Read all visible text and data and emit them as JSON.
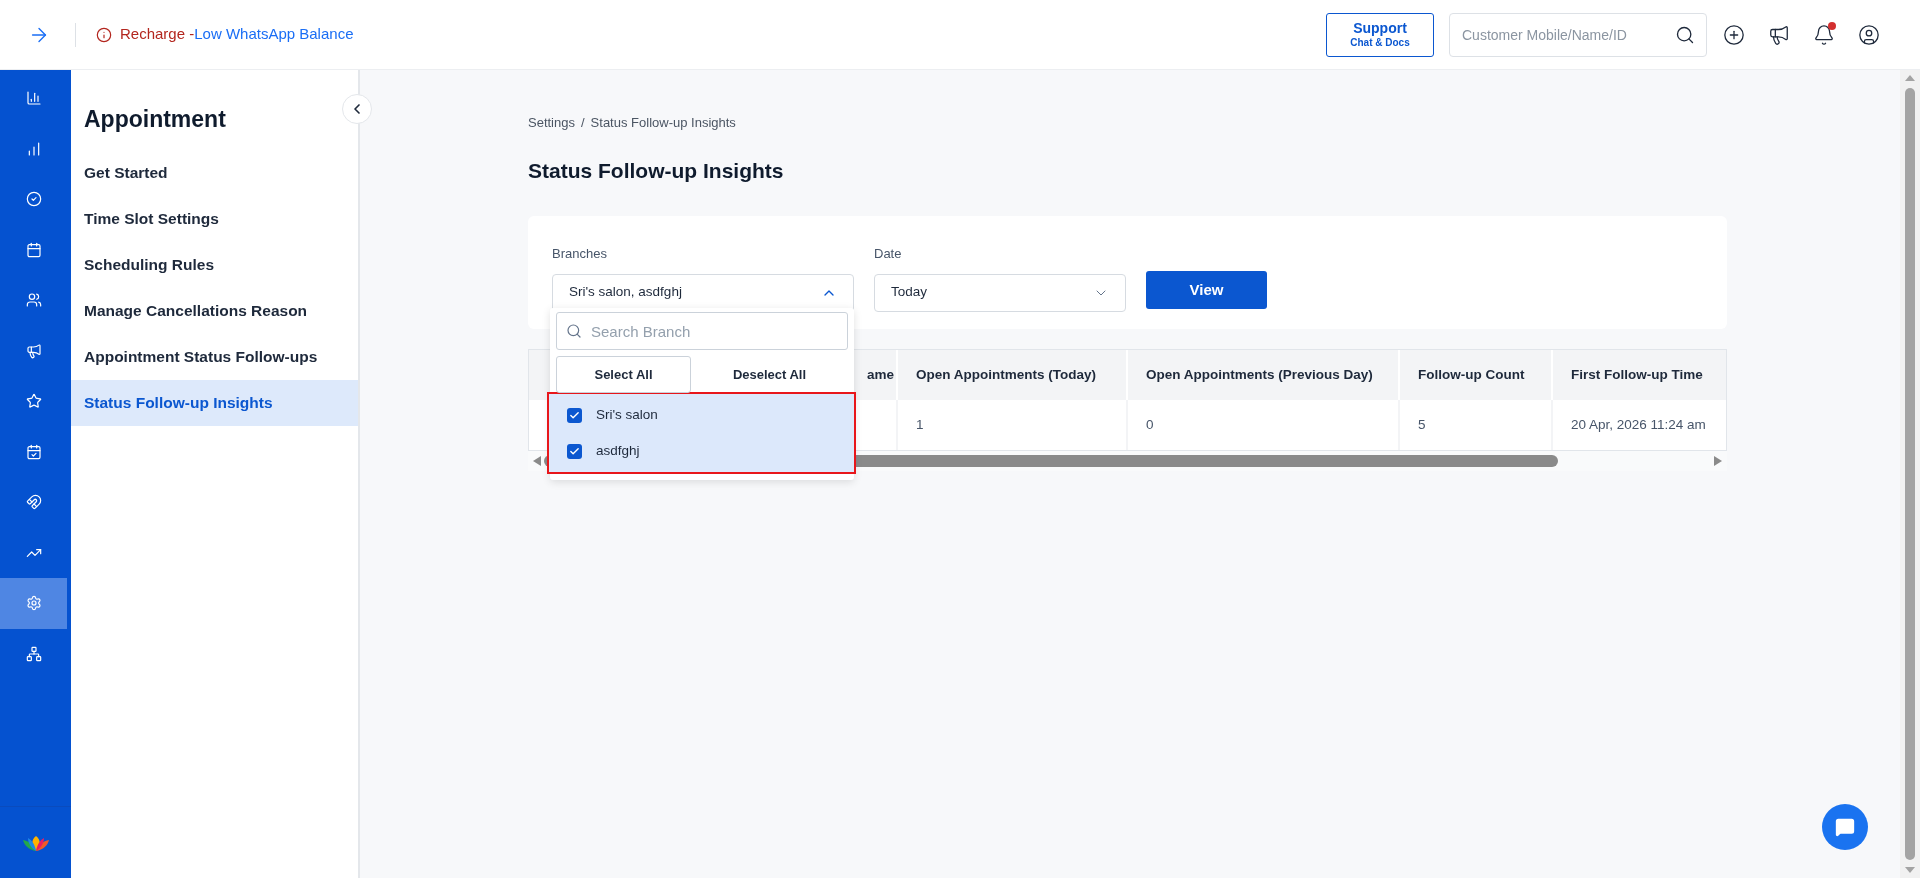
{
  "top_bar": {
    "alert": {
      "label": "Recharge",
      "separator": " - ",
      "link": "Low WhatsApp Balance"
    },
    "support": {
      "title": "Support",
      "subtitle": "Chat & Docs"
    },
    "search": {
      "placeholder": "Customer Mobile/Name/ID"
    },
    "notifications_unread": true
  },
  "rail": [
    {
      "kind": "bar-chart",
      "selected": false
    },
    {
      "kind": "growth",
      "selected": false
    },
    {
      "kind": "check",
      "selected": false
    },
    {
      "kind": "calendar",
      "selected": false
    },
    {
      "kind": "users",
      "selected": false
    },
    {
      "kind": "megaphone",
      "selected": false
    },
    {
      "kind": "star",
      "selected": false
    },
    {
      "kind": "calendar-check",
      "selected": false
    },
    {
      "kind": "magnet",
      "selected": false
    },
    {
      "kind": "trend",
      "selected": false
    },
    {
      "kind": "settings",
      "selected": true
    },
    {
      "kind": "network",
      "selected": false
    }
  ],
  "sidebar": {
    "title": "Appointment",
    "items": [
      {
        "label": "Get Started",
        "selected": false
      },
      {
        "label": "Time Slot Settings",
        "selected": false
      },
      {
        "label": "Scheduling Rules",
        "selected": false
      },
      {
        "label": "Manage Cancellations Reason",
        "selected": false
      },
      {
        "label": "Appointment Status Follow-ups",
        "selected": false
      },
      {
        "label": "Status Follow-up Insights",
        "selected": true
      }
    ]
  },
  "breadcrumb": {
    "items": [
      "Settings",
      "Status Follow-up Insights"
    ],
    "separator": "/"
  },
  "page_title": "Status Follow-up Insights",
  "filters": {
    "branches": {
      "label": "Branches",
      "value": "Sri's salon, asdfghj",
      "expanded": true
    },
    "date": {
      "label": "Date",
      "value": "Today"
    },
    "view_button": "View"
  },
  "branch_dropdown": {
    "search": {
      "placeholder": "Search Branch"
    },
    "select_all": "Select All",
    "deselect_all": "Deselect All",
    "options": [
      {
        "label": "Sri's salon",
        "checked": true
      },
      {
        "label": "asdfghj",
        "checked": true
      }
    ]
  },
  "table": {
    "columns": [
      "",
      "ame",
      "Open Appointments (Today)",
      "Open Appointments (Previous Day)",
      "Follow-up Count",
      "First Follow-up Time"
    ],
    "rows": [
      [
        "",
        "",
        "1",
        "0",
        "5",
        "20 Apr, 2026 11:24 am"
      ]
    ]
  }
}
